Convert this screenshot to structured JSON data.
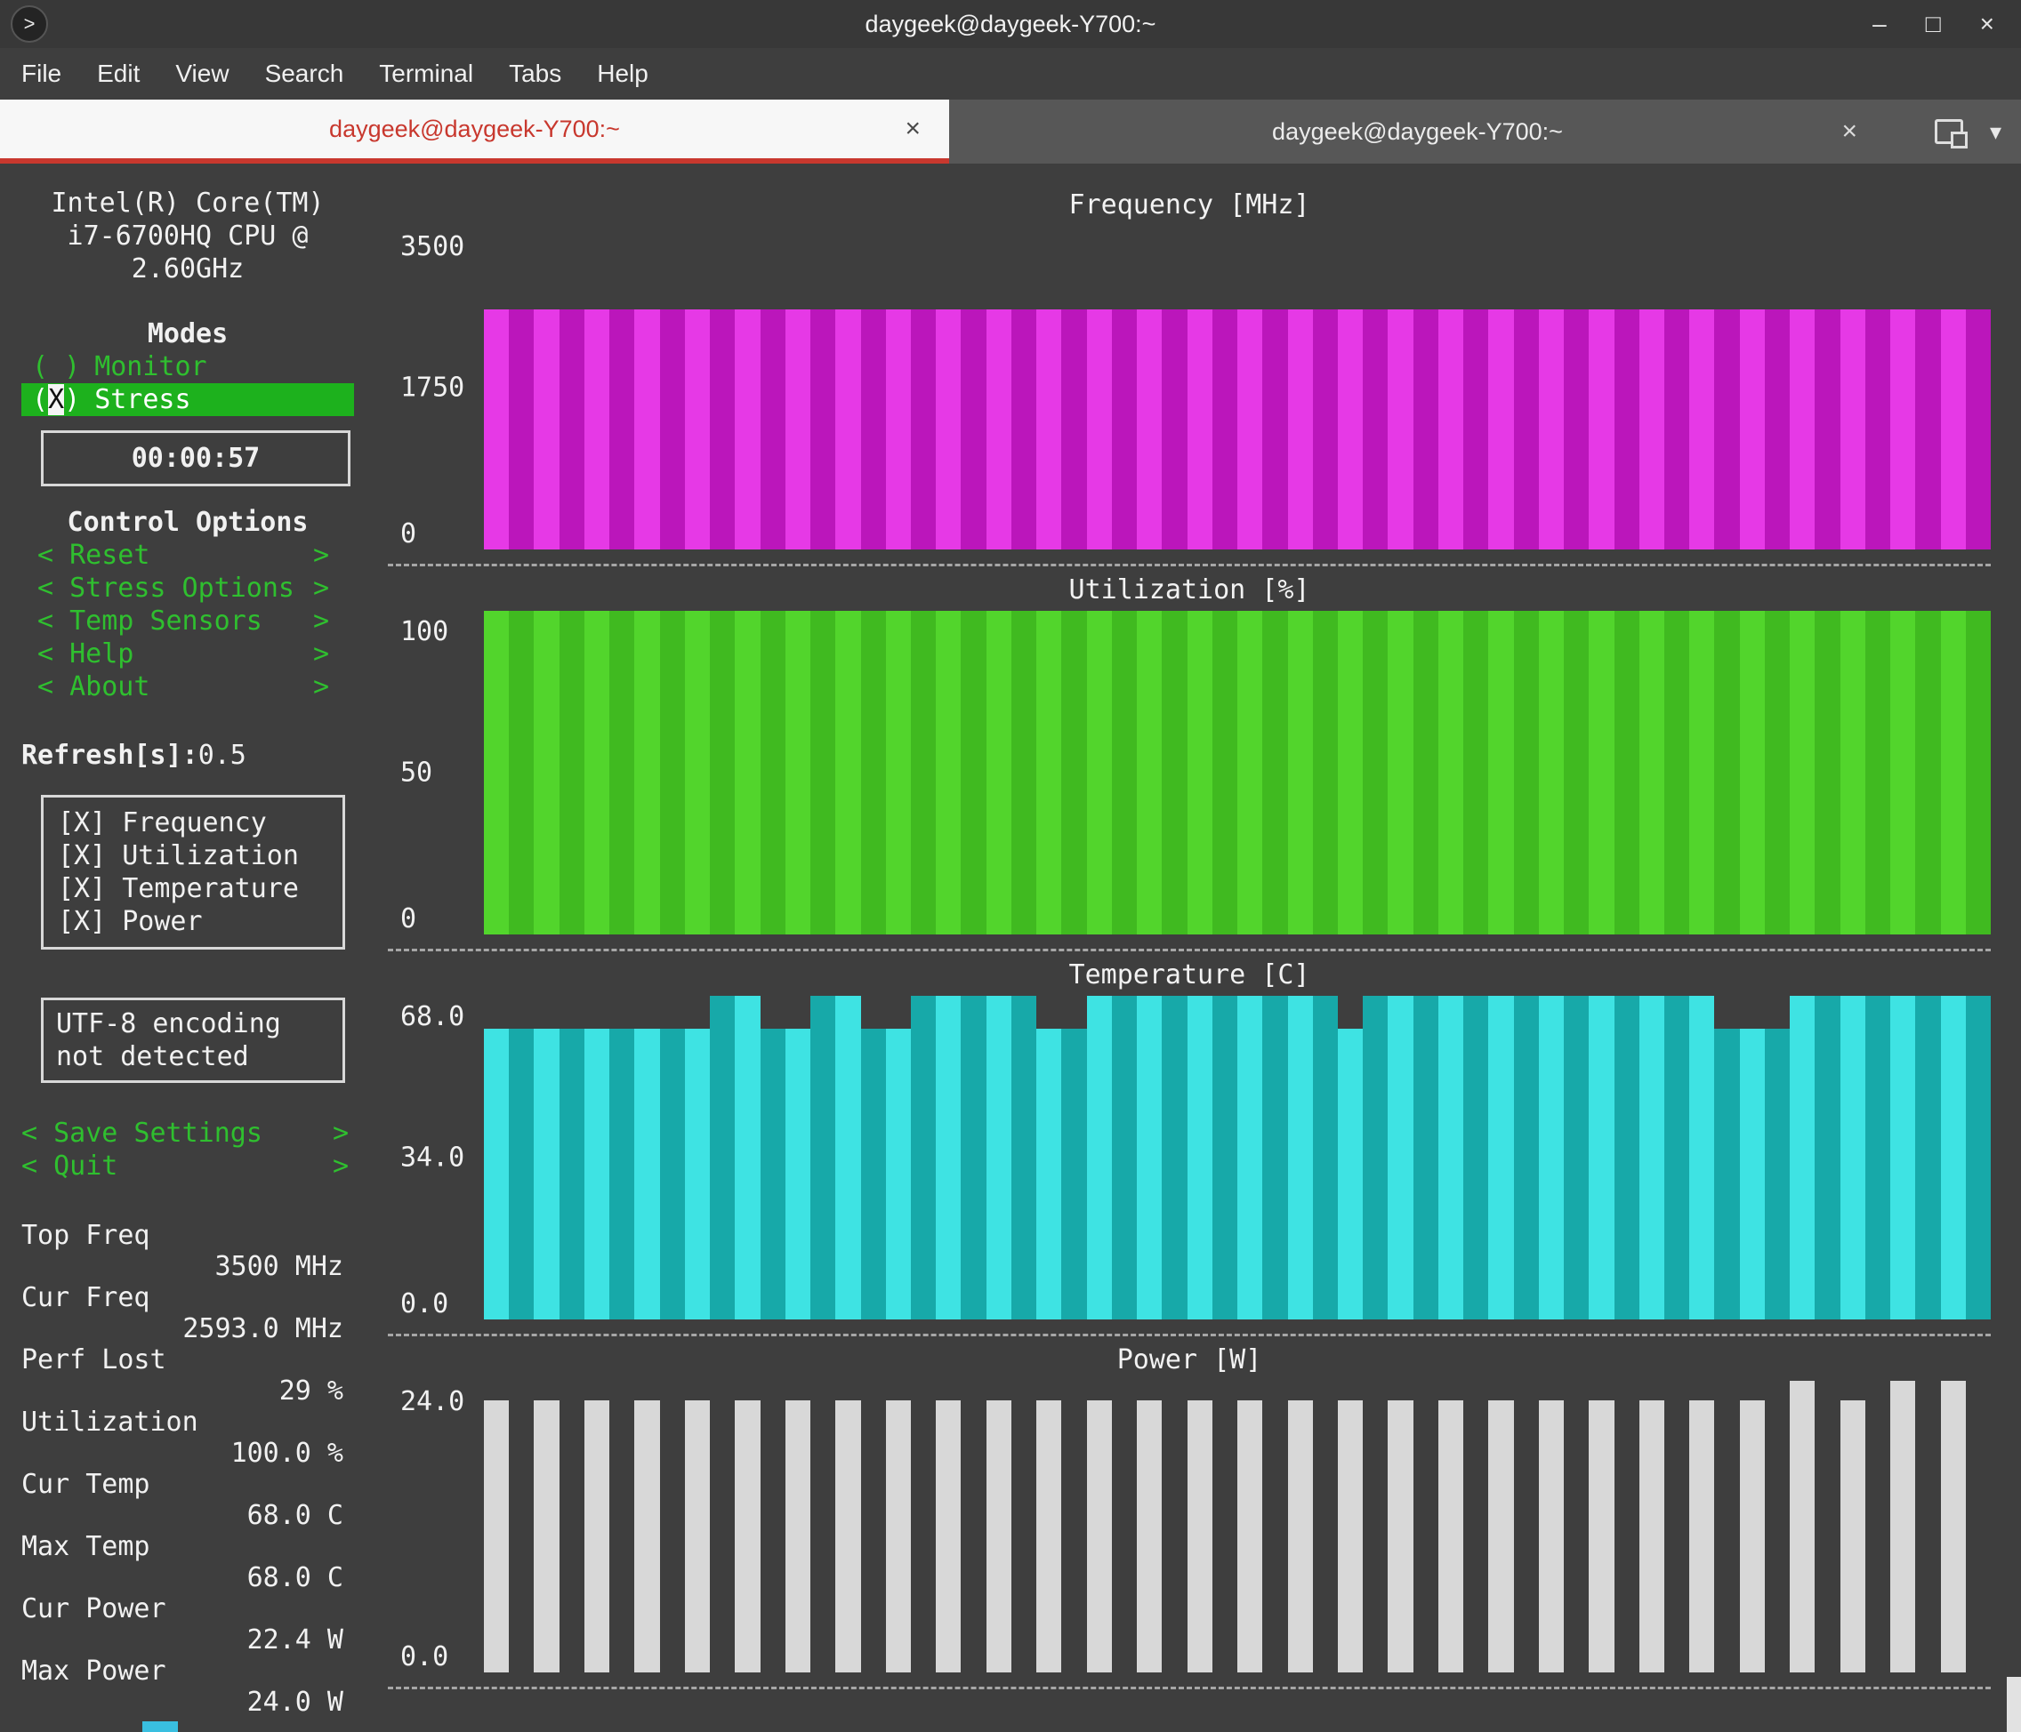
{
  "window": {
    "title": "daygeek@daygeek-Y700:~",
    "controls": {
      "minimize": "–",
      "maximize": "□",
      "close": "×"
    }
  },
  "icons": {
    "app_prompt": ">",
    "close": "×",
    "chevron_down": "▾"
  },
  "menu": {
    "items": [
      "File",
      "Edit",
      "View",
      "Search",
      "Terminal",
      "Tabs",
      "Help"
    ]
  },
  "tabs": [
    {
      "label": "daygeek@daygeek-Y700:~",
      "active": true
    },
    {
      "label": "daygeek@daygeek-Y700:~",
      "active": false
    }
  ],
  "ui": {
    "lt": "<",
    "gt": ">"
  },
  "sidebar": {
    "cpu_name_lines": [
      "Intel(R) Core(TM)",
      "i7-6700HQ CPU @",
      "2.60GHz"
    ],
    "modes": {
      "title": "Modes",
      "monitor": {
        "state": "( )",
        "label": "Monitor"
      },
      "stress": {
        "pre": "(",
        "mark": "X",
        "post": ")",
        "label": "Stress"
      }
    },
    "timer": "00:00:57",
    "control_options_title": "Control Options",
    "control_options": [
      "Reset",
      "Stress Options",
      "Temp Sensors",
      "Help",
      "About"
    ],
    "refresh_label": "Refresh[s]:",
    "refresh_value": "0.5",
    "graph_toggles": [
      {
        "state": "[X]",
        "label": "Frequency"
      },
      {
        "state": "[X]",
        "label": "Utilization"
      },
      {
        "state": "[X]",
        "label": "Temperature"
      },
      {
        "state": "[X]",
        "label": "Power"
      }
    ],
    "notice": "UTF-8 encoding not detected",
    "actions": [
      "Save Settings",
      "Quit"
    ],
    "stats": [
      {
        "label": "Top Freq",
        "value": "3500 MHz"
      },
      {
        "label": "Cur Freq",
        "value": "2593.0 MHz"
      },
      {
        "label": "Perf Lost",
        "value": "29 %"
      },
      {
        "label": "Utilization",
        "value": "100.0 %"
      },
      {
        "label": "Cur Temp",
        "value": "68.0 C"
      },
      {
        "label": "Max Temp",
        "value": "68.0 C"
      },
      {
        "label": "Cur Power",
        "value": "22.4 W"
      },
      {
        "label": "Max Power",
        "value": "24.0 W"
      }
    ]
  },
  "chart_data": [
    {
      "type": "bar",
      "title": "Frequency [MHz]",
      "ylim": [
        0,
        3500
      ],
      "yticks": [
        "3500",
        "1750",
        "0"
      ],
      "bar_colors": {
        "bright": "#e639e6",
        "dark": "#bb16bb"
      },
      "values": [
        2593,
        2593,
        2593,
        2593,
        2593,
        2593,
        2593,
        2593,
        2593,
        2593,
        2593,
        2593,
        2593,
        2593,
        2593,
        2593,
        2593,
        2593,
        2593,
        2593,
        2593,
        2593,
        2593,
        2593,
        2593,
        2593,
        2593,
        2593,
        2593,
        2593,
        2593,
        2593,
        2593,
        2593,
        2593,
        2593,
        2593,
        2593,
        2593,
        2593,
        2593,
        2593,
        2593,
        2593,
        2593,
        2593,
        2593,
        2593,
        2593,
        2593,
        2593,
        2593,
        2593,
        2593,
        2593,
        2593,
        2593,
        2593,
        2593,
        2593
      ]
    },
    {
      "type": "bar",
      "title": "Utilization [%]",
      "ylim": [
        0,
        100
      ],
      "yticks": [
        "100",
        "50",
        "0"
      ],
      "bar_colors": {
        "bright": "#52d52c",
        "dark": "#40ba20"
      },
      "values": [
        100,
        100,
        100,
        100,
        100,
        100,
        100,
        100,
        100,
        100,
        100,
        100,
        100,
        100,
        100,
        100,
        100,
        100,
        100,
        100,
        100,
        100,
        100,
        100,
        100,
        100,
        100,
        100,
        100,
        100,
        100,
        100,
        100,
        100,
        100,
        100,
        100,
        100,
        100,
        100,
        100,
        100,
        100,
        100,
        100,
        100,
        100,
        100,
        100,
        100,
        100,
        100,
        100,
        100,
        100,
        100,
        100,
        100,
        100,
        100
      ]
    },
    {
      "type": "bar",
      "title": "Temperature [C]",
      "ylim": [
        0,
        68
      ],
      "yticks": [
        "68.0",
        "34.0",
        "0.0"
      ],
      "bar_colors": {
        "bright": "#3ee3e3",
        "dark": "#17a9a9"
      },
      "values": [
        61,
        61,
        61,
        61,
        61,
        61,
        61,
        61,
        61,
        68,
        68,
        61,
        61,
        68,
        68,
        61,
        61,
        68,
        68,
        68,
        68,
        68,
        61,
        61,
        68,
        68,
        68,
        68,
        68,
        68,
        68,
        68,
        68,
        68,
        61,
        68,
        68,
        68,
        68,
        68,
        68,
        68,
        68,
        68,
        68,
        68,
        68,
        68,
        68,
        61,
        61,
        61,
        68,
        68,
        68,
        68,
        68,
        68,
        68,
        68
      ]
    },
    {
      "type": "bar",
      "title": "Power [W]",
      "ylim": [
        0,
        24
      ],
      "yticks": [
        "24.0",
        "0.0"
      ],
      "bar_colors": {
        "bright": "#d8d8d8",
        "dark": "#3e3e3e"
      },
      "values": [
        22.4,
        22.4,
        22.4,
        22.4,
        22.4,
        22.4,
        22.4,
        22.4,
        22.4,
        22.4,
        22.4,
        22.4,
        22.4,
        22.4,
        22.4,
        22.4,
        22.4,
        22.4,
        22.4,
        22.4,
        22.4,
        22.4,
        22.4,
        22.4,
        22.4,
        22.4,
        22.4,
        22.4,
        22.4,
        22.4,
        22.4,
        22.4,
        22.4,
        22.4,
        22.4,
        22.4,
        22.4,
        22.4,
        22.4,
        22.4,
        22.4,
        22.4,
        22.4,
        22.4,
        22.4,
        22.4,
        22.4,
        22.4,
        22.4,
        22.4,
        22.4,
        22.4,
        24,
        22.4,
        22.4,
        24,
        24,
        22.4,
        24,
        24
      ]
    }
  ]
}
